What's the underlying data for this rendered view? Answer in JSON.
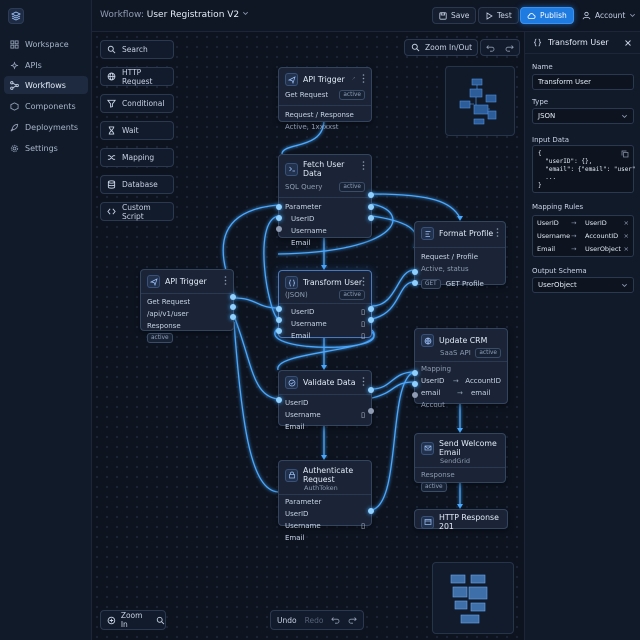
{
  "sidebar": {
    "items": [
      {
        "label": "Workspace",
        "icon": "grid-icon"
      },
      {
        "label": "APIs",
        "icon": "api-icon"
      },
      {
        "label": "Workflows",
        "icon": "workflow-icon",
        "active": true
      },
      {
        "label": "Components",
        "icon": "components-icon"
      },
      {
        "label": "Deployments",
        "icon": "rocket-icon"
      },
      {
        "label": "Settings",
        "icon": "gear-icon"
      }
    ]
  },
  "header": {
    "prefix": "Workflow:",
    "title": "User Registration V2",
    "save": "Save",
    "test": "Test",
    "publish": "Publish",
    "account": "Account"
  },
  "canvas": {
    "zoom_in_out": "Zoom In/Out",
    "zoom_in": "Zoom In",
    "undo": "Undo",
    "redo": "Redo"
  },
  "palette": [
    {
      "label": "Search",
      "icon": "search-icon"
    },
    {
      "label": "HTTP Request",
      "icon": "globe-icon"
    },
    {
      "label": "Conditional",
      "icon": "filter-icon"
    },
    {
      "label": "Wait",
      "icon": "hourglass-icon"
    },
    {
      "label": "Mapping",
      "icon": "shuffle-icon"
    },
    {
      "label": "Database",
      "icon": "database-icon"
    },
    {
      "label": "Custom Script",
      "icon": "code-icon"
    }
  ],
  "nodes": {
    "api_trigger_top": {
      "title": "API Trigger",
      "r1": "Get Request",
      "badge": "active",
      "r2": "Request / Response",
      "r3": "Active, 1xxxxst"
    },
    "fetch_user": {
      "title": "Fetch User Data",
      "sub": "SQL Query",
      "badge": "active",
      "section": "Parameter",
      "f1": "UserID",
      "f2": "Username",
      "f3": "Email"
    },
    "format_profile": {
      "title": "Format Profile",
      "r1": "Request / Profile",
      "r2": "Active, status",
      "action": "GET Profile"
    },
    "api_trigger_left": {
      "title": "API Trigger",
      "r1": "Get Request",
      "r2": "/api/v1/user",
      "r3": "Response",
      "badge": "active"
    },
    "transform_user": {
      "title": "Transform User",
      "sub": "(JSON)",
      "badge": "active",
      "f1": "UserID",
      "f2": "Username",
      "f3": "Email"
    },
    "update_crm": {
      "title": "Update CRM",
      "sub": "SaaS API",
      "badge": "active",
      "section": "Mapping",
      "m1a": "UserID",
      "m1b": "AccountID",
      "m2a": "email",
      "m2b": "email",
      "m3": "Accout"
    },
    "validate": {
      "title": "Validate Data",
      "f1": "UserID",
      "f2": "Username",
      "f3": "Email"
    },
    "welcome": {
      "title": "Send Welcome Email",
      "sub": "SendGrid",
      "section": "Response",
      "badge": "active"
    },
    "auth": {
      "title": "Authenticate Request",
      "sub": "AuthToken",
      "section": "Parameter",
      "f1": "UserID",
      "f2": "Username",
      "f3": "Email"
    },
    "http201": {
      "title": "HTTP Response 201"
    }
  },
  "panel": {
    "title": "Transform User",
    "name_label": "Name",
    "name_value": "Transform User",
    "type_label": "Type",
    "type_value": "JSON",
    "input_label": "Input Data",
    "input_code": "{\n  \"userID\": {},\n  \"email\": {\"email\": \"user\"\n  ...\n}",
    "mapping_label": "Mapping Rules",
    "mappings": [
      {
        "from": "UserID",
        "to": "UserID"
      },
      {
        "from": "Username",
        "to": "AccountID"
      },
      {
        "from": "Email",
        "to": "UserObject"
      }
    ],
    "schema_label": "Output Schema",
    "schema_value": "UserObject"
  },
  "colors": {
    "accent": "#1f7be0",
    "wire": "#49a8ff",
    "panel": "#111a29",
    "canvas": "#0d1420"
  }
}
